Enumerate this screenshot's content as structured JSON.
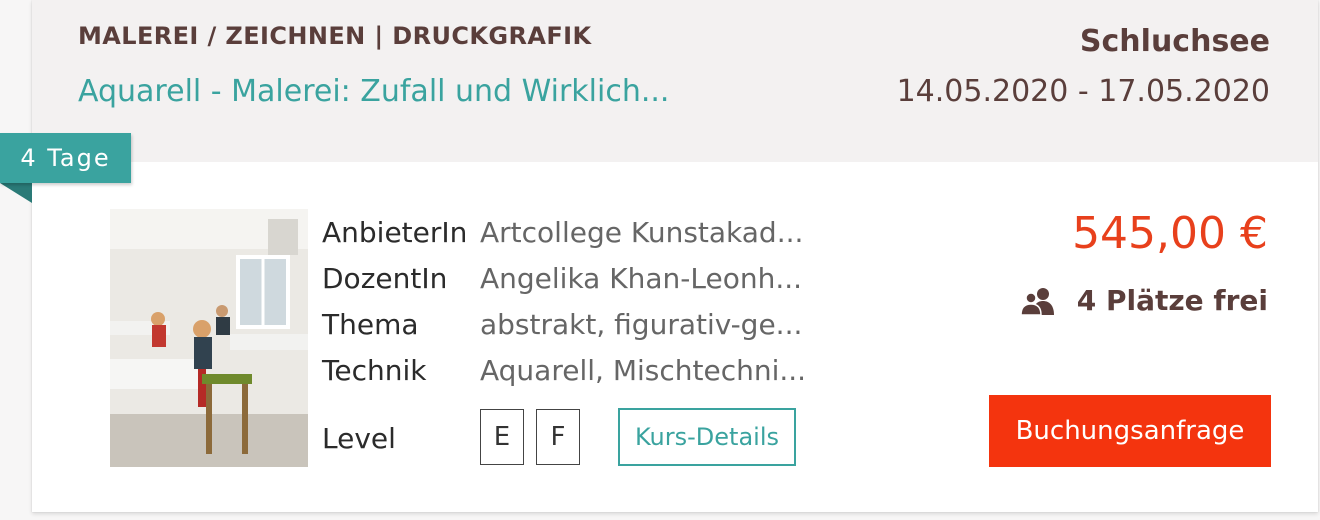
{
  "course": {
    "category": "MALEREI / ZEICHNEN | DRUCKGRAFIK",
    "title": "Aquarell - Malerei: Zufall und Wirklich...",
    "location": "Schluchsee",
    "dates": "14.05.2020 - 17.05.2020",
    "duration_badge": "4 Tage"
  },
  "details": {
    "provider_label": "AnbieterIn",
    "provider_value": "Artcollege Kunstakad...",
    "teacher_label": "DozentIn",
    "teacher_value": "Angelika Khan-Leonh...",
    "topic_label": "Thema",
    "topic_value": "abstrakt, figurativ-ge...",
    "technique_label": "Technik",
    "technique_value": "Aquarell, Mischtechni...",
    "level_label": "Level",
    "levels": [
      "E",
      "F"
    ],
    "details_button": "Kurs-Details"
  },
  "booking": {
    "price": "545,00 €",
    "seats": "4 Plätze frei",
    "button_label": "Buchungsanfrage"
  },
  "colors": {
    "accent_teal": "#3aa39f",
    "price_red": "#e8401c",
    "button_red": "#f4340e",
    "brown_text": "#5a3e3b"
  },
  "icons": {
    "seats": "people-icon",
    "image": "course-photo"
  }
}
